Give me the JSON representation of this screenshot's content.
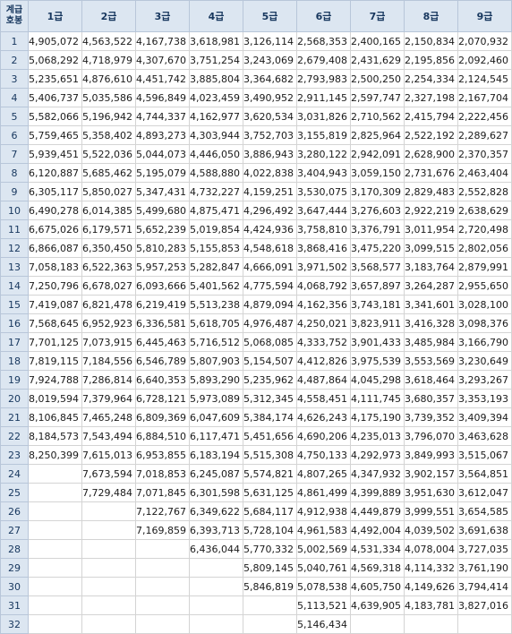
{
  "corner": [
    "계급",
    "호봉"
  ],
  "grades": [
    "1급",
    "2급",
    "3급",
    "4급",
    "5급",
    "6급",
    "7급",
    "8급",
    "9급"
  ],
  "rows": [
    {
      "step": "1",
      "values": [
        "4,905,072",
        "4,563,522",
        "4,167,738",
        "3,618,981",
        "3,126,114",
        "2,568,353",
        "2,400,165",
        "2,150,834",
        "2,070,932"
      ]
    },
    {
      "step": "2",
      "values": [
        "5,068,292",
        "4,718,979",
        "4,307,670",
        "3,751,254",
        "3,243,069",
        "2,679,408",
        "2,431,629",
        "2,195,856",
        "2,092,460"
      ]
    },
    {
      "step": "3",
      "values": [
        "5,235,651",
        "4,876,610",
        "4,451,742",
        "3,885,804",
        "3,364,682",
        "2,793,983",
        "2,500,250",
        "2,254,334",
        "2,124,545"
      ]
    },
    {
      "step": "4",
      "values": [
        "5,406,737",
        "5,035,586",
        "4,596,849",
        "4,023,459",
        "3,490,952",
        "2,911,145",
        "2,597,747",
        "2,327,198",
        "2,167,704"
      ]
    },
    {
      "step": "5",
      "values": [
        "5,582,066",
        "5,196,942",
        "4,744,337",
        "4,162,977",
        "3,620,534",
        "3,031,826",
        "2,710,562",
        "2,415,794",
        "2,222,456"
      ]
    },
    {
      "step": "6",
      "values": [
        "5,759,465",
        "5,358,402",
        "4,893,273",
        "4,303,944",
        "3,752,703",
        "3,155,819",
        "2,825,964",
        "2,522,192",
        "2,289,627"
      ]
    },
    {
      "step": "7",
      "values": [
        "5,939,451",
        "5,522,036",
        "5,044,073",
        "4,446,050",
        "3,886,943",
        "3,280,122",
        "2,942,091",
        "2,628,900",
        "2,370,357"
      ]
    },
    {
      "step": "8",
      "values": [
        "6,120,887",
        "5,685,462",
        "5,195,079",
        "4,588,880",
        "4,022,838",
        "3,404,943",
        "3,059,150",
        "2,731,676",
        "2,463,404"
      ]
    },
    {
      "step": "9",
      "values": [
        "6,305,117",
        "5,850,027",
        "5,347,431",
        "4,732,227",
        "4,159,251",
        "3,530,075",
        "3,170,309",
        "2,829,483",
        "2,552,828"
      ]
    },
    {
      "step": "10",
      "values": [
        "6,490,278",
        "6,014,385",
        "5,499,680",
        "4,875,471",
        "4,296,492",
        "3,647,444",
        "3,276,603",
        "2,922,219",
        "2,638,629"
      ]
    },
    {
      "step": "11",
      "values": [
        "6,675,026",
        "6,179,571",
        "5,652,239",
        "5,019,854",
        "4,424,936",
        "3,758,810",
        "3,376,791",
        "3,011,954",
        "2,720,498"
      ]
    },
    {
      "step": "12",
      "values": [
        "6,866,087",
        "6,350,450",
        "5,810,283",
        "5,155,853",
        "4,548,618",
        "3,868,416",
        "3,475,220",
        "3,099,515",
        "2,802,056"
      ]
    },
    {
      "step": "13",
      "values": [
        "7,058,183",
        "6,522,363",
        "5,957,253",
        "5,282,847",
        "4,666,091",
        "3,971,502",
        "3,568,577",
        "3,183,764",
        "2,879,991"
      ]
    },
    {
      "step": "14",
      "values": [
        "7,250,796",
        "6,678,027",
        "6,093,666",
        "5,401,562",
        "4,775,594",
        "4,068,792",
        "3,657,897",
        "3,264,287",
        "2,955,650"
      ]
    },
    {
      "step": "15",
      "values": [
        "7,419,087",
        "6,821,478",
        "6,219,419",
        "5,513,238",
        "4,879,094",
        "4,162,356",
        "3,743,181",
        "3,341,601",
        "3,028,100"
      ]
    },
    {
      "step": "16",
      "values": [
        "7,568,645",
        "6,952,923",
        "6,336,581",
        "5,618,705",
        "4,976,487",
        "4,250,021",
        "3,823,911",
        "3,416,328",
        "3,098,376"
      ]
    },
    {
      "step": "17",
      "values": [
        "7,701,125",
        "7,073,915",
        "6,445,463",
        "5,716,512",
        "5,068,085",
        "4,333,752",
        "3,901,433",
        "3,485,984",
        "3,166,790"
      ]
    },
    {
      "step": "18",
      "values": [
        "7,819,115",
        "7,184,556",
        "6,546,789",
        "5,807,903",
        "5,154,507",
        "4,412,826",
        "3,975,539",
        "3,553,569",
        "3,230,649"
      ]
    },
    {
      "step": "19",
      "values": [
        "7,924,788",
        "7,286,814",
        "6,640,353",
        "5,893,290",
        "5,235,962",
        "4,487,864",
        "4,045,298",
        "3,618,464",
        "3,293,267"
      ]
    },
    {
      "step": "20",
      "values": [
        "8,019,594",
        "7,379,964",
        "6,728,121",
        "5,973,089",
        "5,312,345",
        "4,558,451",
        "4,111,745",
        "3,680,357",
        "3,353,193"
      ]
    },
    {
      "step": "21",
      "values": [
        "8,106,845",
        "7,465,248",
        "6,809,369",
        "6,047,609",
        "5,384,174",
        "4,626,243",
        "4,175,190",
        "3,739,352",
        "3,409,394"
      ]
    },
    {
      "step": "22",
      "values": [
        "8,184,573",
        "7,543,494",
        "6,884,510",
        "6,117,471",
        "5,451,656",
        "4,690,206",
        "4,235,013",
        "3,796,070",
        "3,463,628"
      ]
    },
    {
      "step": "23",
      "values": [
        "8,250,399",
        "7,615,013",
        "6,953,855",
        "6,183,194",
        "5,515,308",
        "4,750,133",
        "4,292,973",
        "3,849,993",
        "3,515,067"
      ]
    },
    {
      "step": "24",
      "values": [
        "",
        "7,673,594",
        "7,018,853",
        "6,245,087",
        "5,574,821",
        "4,807,265",
        "4,347,932",
        "3,902,157",
        "3,564,851"
      ]
    },
    {
      "step": "25",
      "values": [
        "",
        "7,729,484",
        "7,071,845",
        "6,301,598",
        "5,631,125",
        "4,861,499",
        "4,399,889",
        "3,951,630",
        "3,612,047"
      ]
    },
    {
      "step": "26",
      "values": [
        "",
        "",
        "7,122,767",
        "6,349,622",
        "5,684,117",
        "4,912,938",
        "4,449,879",
        "3,999,551",
        "3,654,585"
      ]
    },
    {
      "step": "27",
      "values": [
        "",
        "",
        "7,169,859",
        "6,393,713",
        "5,728,104",
        "4,961,583",
        "4,492,004",
        "4,039,502",
        "3,691,638"
      ]
    },
    {
      "step": "28",
      "values": [
        "",
        "",
        "",
        "6,436,044",
        "5,770,332",
        "5,002,569",
        "4,531,334",
        "4,078,004",
        "3,727,035"
      ]
    },
    {
      "step": "29",
      "values": [
        "",
        "",
        "",
        "",
        "5,809,145",
        "5,040,761",
        "4,569,318",
        "4,114,332",
        "3,761,190"
      ]
    },
    {
      "step": "30",
      "values": [
        "",
        "",
        "",
        "",
        "5,846,819",
        "5,078,538",
        "4,605,750",
        "4,149,626",
        "3,794,414"
      ]
    },
    {
      "step": "31",
      "values": [
        "",
        "",
        "",
        "",
        "",
        "5,113,521",
        "4,639,905",
        "4,183,781",
        "3,827,016"
      ]
    },
    {
      "step": "32",
      "values": [
        "",
        "",
        "",
        "",
        "",
        "5,146,434",
        "",
        "",
        ""
      ]
    }
  ],
  "colors": {
    "header_bg": "#dce6f1",
    "header_text": "#17375e",
    "grid": "#d4d4d4"
  }
}
